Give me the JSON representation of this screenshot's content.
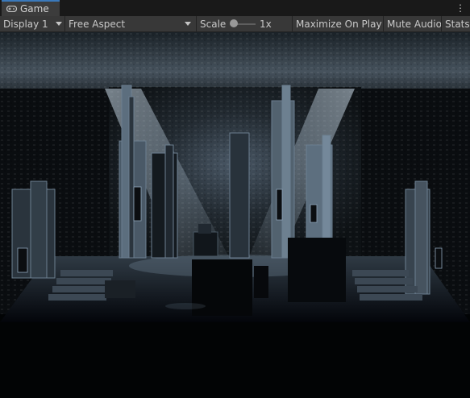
{
  "tab": {
    "label": "Game",
    "icon": "gamepad-icon"
  },
  "window_menu_icon": "kebab-menu-icon",
  "toolbar": {
    "display": "Display 1",
    "aspect": "Free Aspect",
    "scale_label": "Scale",
    "scale_value": "1x",
    "maximize": "Maximize On Play",
    "mute": "Mute Audio",
    "stats": "Stats"
  },
  "colors": {
    "tab_accent": "#3a79bb",
    "toolbar_bg": "#383838",
    "scene_light": "#8fa6bb"
  }
}
